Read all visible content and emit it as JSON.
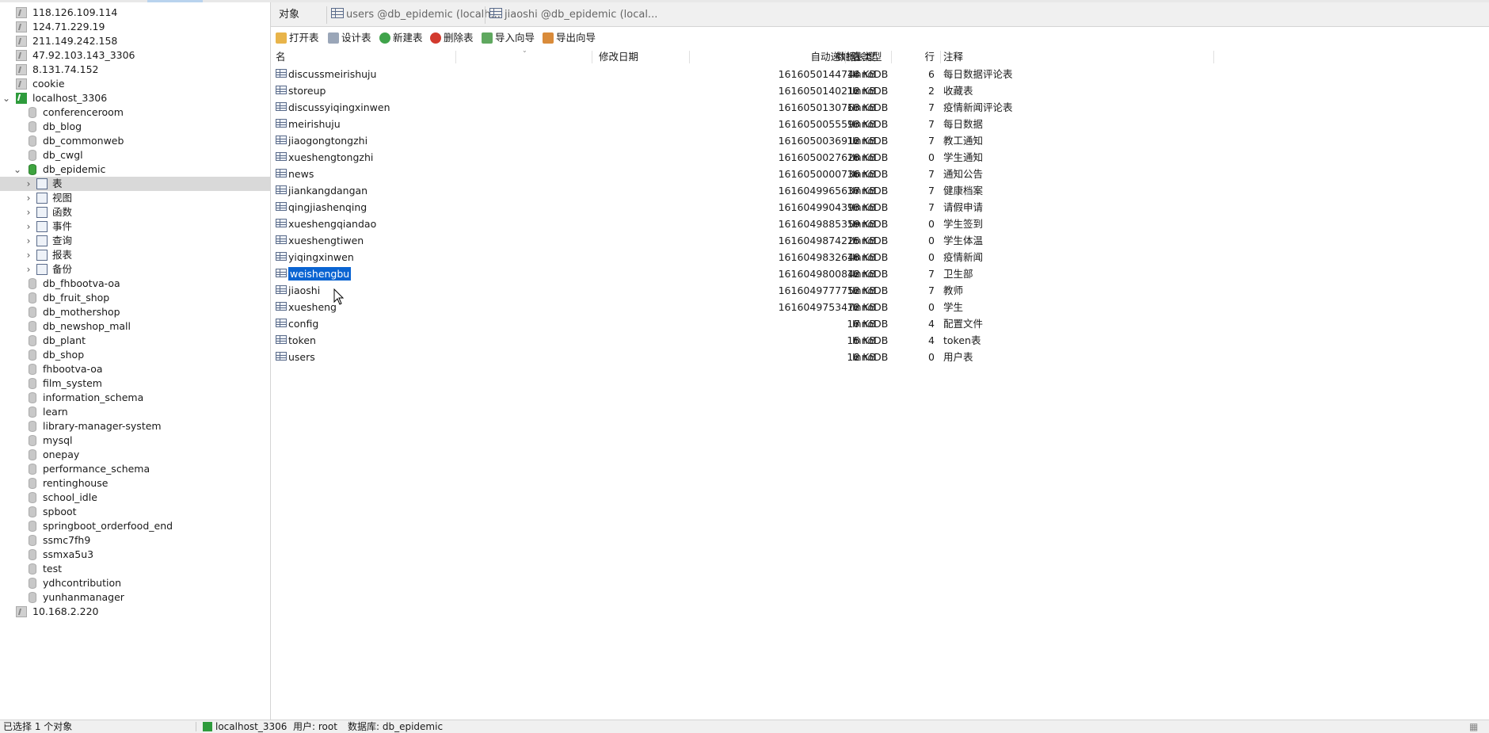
{
  "sidebar": {
    "items": [
      {
        "label": "118.126.109.114",
        "kind": "conn-gray",
        "level": 0,
        "arrow": ""
      },
      {
        "label": "124.71.229.19",
        "kind": "conn-gray",
        "level": 0,
        "arrow": ""
      },
      {
        "label": "211.149.242.158",
        "kind": "conn-gray",
        "level": 0,
        "arrow": ""
      },
      {
        "label": "47.92.103.143_3306",
        "kind": "conn-gray",
        "level": 0,
        "arrow": ""
      },
      {
        "label": "8.131.74.152",
        "kind": "conn-gray",
        "level": 0,
        "arrow": ""
      },
      {
        "label": "cookie",
        "kind": "conn-gray",
        "level": 0,
        "arrow": ""
      },
      {
        "label": "localhost_3306",
        "kind": "conn-green",
        "level": 0,
        "arrow": "⌄"
      },
      {
        "label": "conferenceroom",
        "kind": "db-gray",
        "level": 1,
        "arrow": ""
      },
      {
        "label": "db_blog",
        "kind": "db-gray",
        "level": 1,
        "arrow": ""
      },
      {
        "label": "db_commonweb",
        "kind": "db-gray",
        "level": 1,
        "arrow": ""
      },
      {
        "label": "db_cwgl",
        "kind": "db-gray",
        "level": 1,
        "arrow": ""
      },
      {
        "label": "db_epidemic",
        "kind": "db-green",
        "level": 1,
        "arrow": "⌄"
      },
      {
        "label": "表",
        "kind": "table-node",
        "level": 2,
        "arrow": "›",
        "selected": true
      },
      {
        "label": "视图",
        "kind": "view-node",
        "level": 2,
        "arrow": "›"
      },
      {
        "label": "函数",
        "kind": "func-node",
        "level": 2,
        "arrow": "›"
      },
      {
        "label": "事件",
        "kind": "event-node",
        "level": 2,
        "arrow": "›"
      },
      {
        "label": "查询",
        "kind": "query-node",
        "level": 2,
        "arrow": "›"
      },
      {
        "label": "报表",
        "kind": "report-node",
        "level": 2,
        "arrow": "›"
      },
      {
        "label": "备份",
        "kind": "backup-node",
        "level": 2,
        "arrow": "›"
      },
      {
        "label": "db_fhbootva-oa",
        "kind": "db-gray",
        "level": 1,
        "arrow": ""
      },
      {
        "label": "db_fruit_shop",
        "kind": "db-gray",
        "level": 1,
        "arrow": ""
      },
      {
        "label": "db_mothershop",
        "kind": "db-gray",
        "level": 1,
        "arrow": ""
      },
      {
        "label": "db_newshop_mall",
        "kind": "db-gray",
        "level": 1,
        "arrow": ""
      },
      {
        "label": "db_plant",
        "kind": "db-gray",
        "level": 1,
        "arrow": ""
      },
      {
        "label": "db_shop",
        "kind": "db-gray",
        "level": 1,
        "arrow": ""
      },
      {
        "label": "fhbootva-oa",
        "kind": "db-gray",
        "level": 1,
        "arrow": ""
      },
      {
        "label": "film_system",
        "kind": "db-gray",
        "level": 1,
        "arrow": ""
      },
      {
        "label": "information_schema",
        "kind": "db-gray",
        "level": 1,
        "arrow": ""
      },
      {
        "label": "learn",
        "kind": "db-gray",
        "level": 1,
        "arrow": ""
      },
      {
        "label": "library-manager-system",
        "kind": "db-gray",
        "level": 1,
        "arrow": ""
      },
      {
        "label": "mysql",
        "kind": "db-gray",
        "level": 1,
        "arrow": ""
      },
      {
        "label": "onepay",
        "kind": "db-gray",
        "level": 1,
        "arrow": ""
      },
      {
        "label": "performance_schema",
        "kind": "db-gray",
        "level": 1,
        "arrow": ""
      },
      {
        "label": "rentinghouse",
        "kind": "db-gray",
        "level": 1,
        "arrow": ""
      },
      {
        "label": "school_idle",
        "kind": "db-gray",
        "level": 1,
        "arrow": ""
      },
      {
        "label": "spboot",
        "kind": "db-gray",
        "level": 1,
        "arrow": ""
      },
      {
        "label": "springboot_orderfood_end",
        "kind": "db-gray",
        "level": 1,
        "arrow": ""
      },
      {
        "label": "ssmc7fh9",
        "kind": "db-gray",
        "level": 1,
        "arrow": ""
      },
      {
        "label": "ssmxa5u3",
        "kind": "db-gray",
        "level": 1,
        "arrow": ""
      },
      {
        "label": "test",
        "kind": "db-gray",
        "level": 1,
        "arrow": ""
      },
      {
        "label": "ydhcontribution",
        "kind": "db-gray",
        "level": 1,
        "arrow": ""
      },
      {
        "label": "yunhanmanager",
        "kind": "db-gray",
        "level": 1,
        "arrow": ""
      },
      {
        "label": "10.168.2.220",
        "kind": "conn-gray",
        "level": 0,
        "arrow": ""
      }
    ]
  },
  "tabs": [
    {
      "label": "对象",
      "icon": false
    },
    {
      "label": "users @db_epidemic (localh...",
      "icon": true
    },
    {
      "label": "jiaoshi @db_epidemic (local...",
      "icon": true
    }
  ],
  "toolbar": {
    "open": "打开表",
    "design": "设计表",
    "new": "新建表",
    "delete": "删除表",
    "import": "导入向导",
    "export": "导出向导"
  },
  "grid": {
    "headers": {
      "name": "名",
      "auto_inc": "自动递增值",
      "modified": "修改日期",
      "data_len": "数据长度",
      "engine": "表类型",
      "rows": "行",
      "comment": "注释"
    },
    "rows": [
      {
        "name": "discussmeirishuju",
        "auto_inc": "1616050144744",
        "data_len": "16 KB",
        "engine": "InnoDB",
        "rows": "6",
        "comment": "每日数据评论表"
      },
      {
        "name": "storeup",
        "auto_inc": "1616050140212",
        "data_len": "16 KB",
        "engine": "InnoDB",
        "rows": "2",
        "comment": "收藏表"
      },
      {
        "name": "discussyiqingxinwen",
        "auto_inc": "1616050130763",
        "data_len": "16 KB",
        "engine": "InnoDB",
        "rows": "7",
        "comment": "疫情新闻评论表"
      },
      {
        "name": "meirishuju",
        "auto_inc": "1616050055593",
        "data_len": "16 KB",
        "engine": "InnoDB",
        "rows": "7",
        "comment": "每日数据"
      },
      {
        "name": "jiaogongtongzhi",
        "auto_inc": "1616050036912",
        "data_len": "16 KB",
        "engine": "InnoDB",
        "rows": "7",
        "comment": "教工通知"
      },
      {
        "name": "xueshengtongzhi",
        "auto_inc": "1616050027628",
        "data_len": "16 KB",
        "engine": "InnoDB",
        "rows": "0",
        "comment": "学生通知"
      },
      {
        "name": "news",
        "auto_inc": "1616050000736",
        "data_len": "16 KB",
        "engine": "InnoDB",
        "rows": "7",
        "comment": "通知公告"
      },
      {
        "name": "jiankangdangan",
        "auto_inc": "1616049965637",
        "data_len": "16 KB",
        "engine": "InnoDB",
        "rows": "7",
        "comment": "健康档案"
      },
      {
        "name": "qingjiashenqing",
        "auto_inc": "1616049904393",
        "data_len": "16 KB",
        "engine": "InnoDB",
        "rows": "7",
        "comment": "请假申请"
      },
      {
        "name": "xueshengqiandao",
        "auto_inc": "1616049885359",
        "data_len": "16 KB",
        "engine": "InnoDB",
        "rows": "0",
        "comment": "学生签到"
      },
      {
        "name": "xueshengtiwen",
        "auto_inc": "1616049874225",
        "data_len": "16 KB",
        "engine": "InnoDB",
        "rows": "0",
        "comment": "学生体温"
      },
      {
        "name": "yiqingxinwen",
        "auto_inc": "1616049832648",
        "data_len": "16 KB",
        "engine": "InnoDB",
        "rows": "0",
        "comment": "疫情新闻"
      },
      {
        "name": "weishengbu",
        "auto_inc": "1616049800842",
        "data_len": "16 KB",
        "engine": "InnoDB",
        "rows": "7",
        "comment": "卫生部",
        "selected": true
      },
      {
        "name": "jiaoshi",
        "auto_inc": "1616049777752",
        "data_len": "16 KB",
        "engine": "InnoDB",
        "rows": "7",
        "comment": "教师"
      },
      {
        "name": "xuesheng",
        "auto_inc": "1616049753472",
        "data_len": "16 KB",
        "engine": "InnoDB",
        "rows": "0",
        "comment": "学生"
      },
      {
        "name": "config",
        "auto_inc": "7",
        "data_len": "16 KB",
        "engine": "InnoDB",
        "rows": "4",
        "comment": "配置文件"
      },
      {
        "name": "token",
        "auto_inc": "5",
        "data_len": "16 KB",
        "engine": "InnoDB",
        "rows": "4",
        "comment": "token表"
      },
      {
        "name": "users",
        "auto_inc": "2",
        "data_len": "16 KB",
        "engine": "InnoDB",
        "rows": "0",
        "comment": "用户表"
      }
    ]
  },
  "status": {
    "selection": "已选择 1 个对象",
    "connection": "localhost_3306",
    "user": "用户: root",
    "database": "数据库: db_epidemic"
  },
  "colors": {
    "selection": "#0a64d2",
    "tree_selected": "#d9d9d9",
    "conn_green": "#2e9b3c"
  }
}
